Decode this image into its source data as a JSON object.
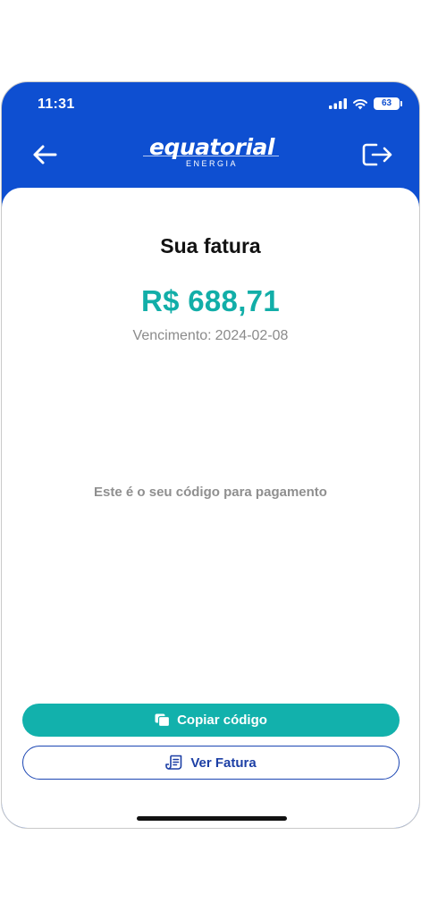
{
  "status_bar": {
    "time": "11:31",
    "battery": "63"
  },
  "header": {
    "logo_text": "equatorial",
    "logo_subtext": "ENERGIA"
  },
  "invoice": {
    "title": "Sua fatura",
    "amount": "R$ 688,71",
    "due_label": "Vencimento:",
    "due_date": "2024-02-08",
    "payment_code_label": "Este é o seu código para pagamento"
  },
  "actions": {
    "copy_label": "Copiar código",
    "view_label": "Ver Fatura"
  },
  "colors": {
    "header_bg": "#0e4fd1",
    "accent_teal": "#12b1ac",
    "outline_blue": "#1c46b3"
  },
  "icons": {
    "back": "arrow-left-icon",
    "logout": "logout-icon",
    "copy": "copy-icon",
    "invoice": "invoice-icon",
    "signal": "cellular-signal-icon",
    "wifi": "wifi-icon",
    "battery": "battery-icon"
  }
}
